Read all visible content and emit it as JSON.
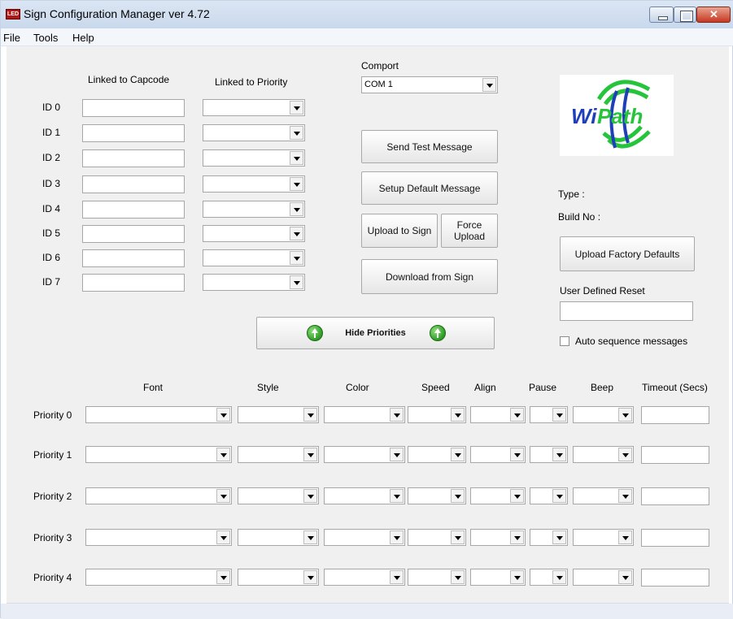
{
  "window": {
    "title": "Sign Configuration Manager ver 4.72",
    "icon_label": "LED"
  },
  "menu": [
    "File",
    "Tools",
    "Help"
  ],
  "ids": {
    "col_capcode": "Linked to Capcode",
    "col_priority": "Linked to Priority",
    "rows": [
      "ID  0",
      "ID  1",
      "ID  2",
      "ID  3",
      "ID  4",
      "ID  5",
      "ID  6",
      "ID  7"
    ]
  },
  "comport": {
    "label": "Comport",
    "value": "COM 1"
  },
  "buttons": {
    "send_test": "Send Test Message",
    "setup_default": "Setup Default Message",
    "upload_to_sign": "Upload to Sign",
    "force_upload": "Force Upload",
    "download_from_sign": "Download from Sign",
    "upload_factory": "Upload Factory Defaults",
    "hide_priorities": "Hide Priorities"
  },
  "info": {
    "type_label": "Type :",
    "build_label": "Build No :"
  },
  "reset": {
    "label": "User Defined Reset",
    "value": ""
  },
  "auto_seq": {
    "label": "Auto sequence messages",
    "checked": false
  },
  "logo": {
    "text": "WiPath",
    "color_blue": "#1f3fb8",
    "color_green": "#26c43b"
  },
  "priorities": {
    "headers": [
      "Font",
      "Style",
      "Color",
      "Speed",
      "Align",
      "Pause",
      "Beep",
      "Timeout (Secs)"
    ],
    "rows": [
      "Priority 0",
      "Priority 1",
      "Priority 2",
      "Priority 3",
      "Priority 4"
    ]
  }
}
